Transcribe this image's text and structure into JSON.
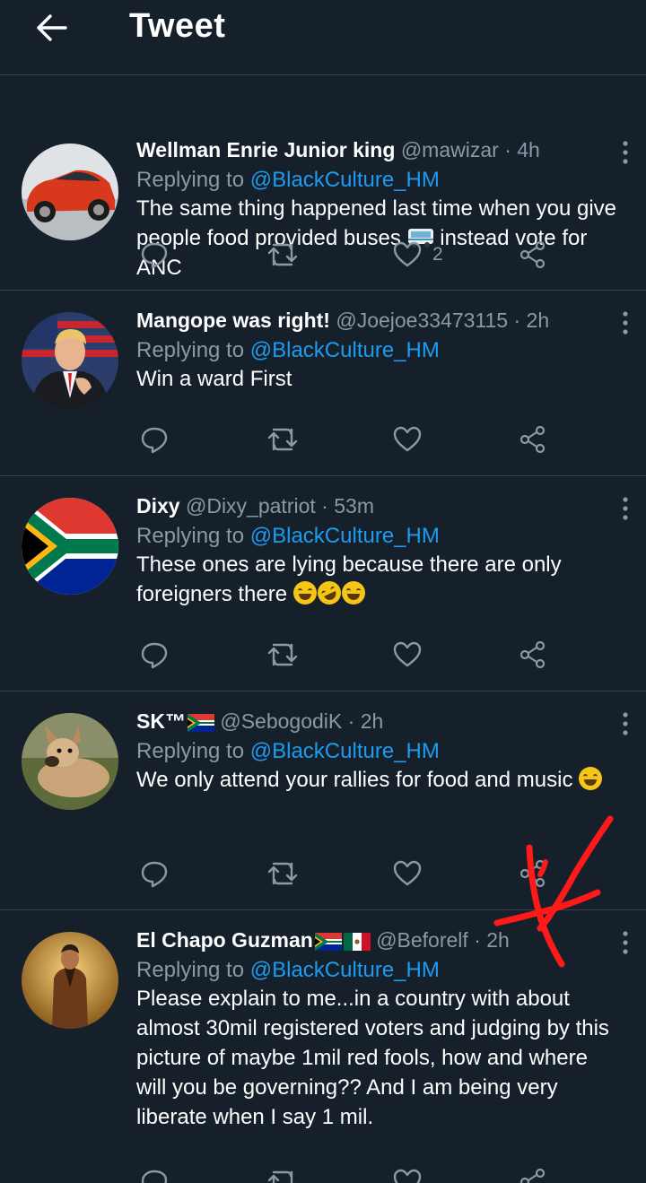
{
  "header": {
    "title": "Tweet",
    "back_icon": "arrow-left-icon"
  },
  "tweets": [
    {
      "name": "Wellman Enrie Junior king",
      "handle": "@mawizar",
      "time": "4h",
      "replying_label": "Replying to",
      "replying_to": "@BlackCulture_HM",
      "text_1": "The same thing happened last time when you give people food provided buses",
      "text_2": "instead vote for ANC",
      "likes": "2",
      "avatar": "red-car"
    },
    {
      "name": "Mangope was right!",
      "handle": "@Joejoe33473115",
      "time": "2h",
      "replying_label": "Replying to",
      "replying_to": "@BlackCulture_HM",
      "text_1": "Win a ward First",
      "avatar": "man-in-suit"
    },
    {
      "name": "Dixy",
      "handle": "@Dixy_patriot",
      "time": "53m",
      "replying_label": "Replying to",
      "replying_to": "@BlackCulture_HM",
      "text_1": "These ones are lying  because  there are only foreigners  there",
      "avatar": "south-africa-flag"
    },
    {
      "name": "SK™",
      "handle": "@SebogodiK",
      "time": "2h",
      "replying_label": "Replying to",
      "replying_to": "@BlackCulture_HM",
      "text_1": "We only attend your rallies for food and music",
      "avatar": "dog"
    },
    {
      "name": "El Chapo Guzman",
      "handle": "@Beforelf",
      "time": "2h",
      "replying_label": "Replying to",
      "replying_to": "@BlackCulture_HM",
      "text_1": "Please explain to me...in a country with about almost 30mil registered voters and judging by this picture of maybe 1mil red fools, how and where will you be governing??  And I am being very liberate when I say 1 mil.",
      "avatar": "man-in-jacket"
    }
  ],
  "colors": {
    "background": "#15202b",
    "accent": "#1d9bf0",
    "muted": "#8b98a5",
    "divider": "#38444d",
    "annotation": "#ff1a1a"
  }
}
